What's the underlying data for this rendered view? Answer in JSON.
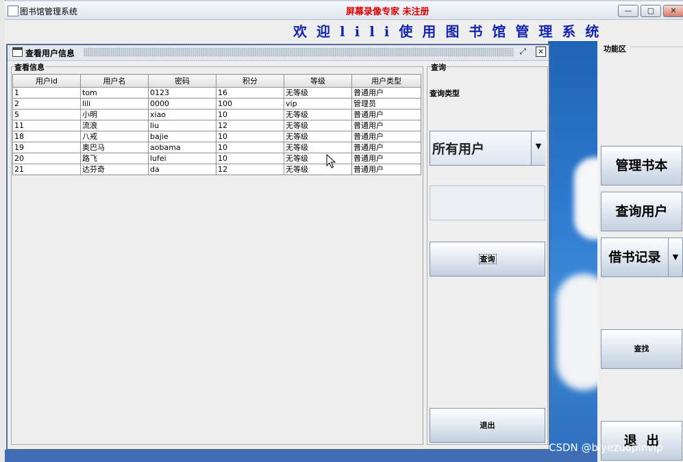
{
  "window": {
    "title": "图书馆管理系统",
    "recorder_watermark": "屏幕录像专家  未注册",
    "controls": [
      "—",
      "▢",
      "✕"
    ]
  },
  "banner": "欢迎lili使用图书馆管理系统",
  "internal_frame": {
    "title": "查看用户信息",
    "view_group_label": "查看信息",
    "query_group_label": "查询",
    "query_type_label": "查询类型",
    "user_type_combo": "所有用户",
    "query_field_value": "",
    "query_button": "查询",
    "exit_button": "退出"
  },
  "table": {
    "columns": [
      "用户id",
      "用户名",
      "密码",
      "积分",
      "等级",
      "用户类型"
    ],
    "rows": [
      [
        "1",
        "tom",
        "0123",
        "16",
        "无等级",
        "普通用户"
      ],
      [
        "2",
        "lili",
        "0000",
        "100",
        "vip",
        "管理员"
      ],
      [
        "5",
        "小明",
        "xiao",
        "10",
        "无等级",
        "普通用户"
      ],
      [
        "11",
        "流浪",
        "liu",
        "12",
        "无等级",
        "普通用户"
      ],
      [
        "18",
        "八戒",
        "bajie",
        "10",
        "无等级",
        "普通用户"
      ],
      [
        "19",
        "奥巴马",
        "aobama",
        "10",
        "无等级",
        "普通用户"
      ],
      [
        "20",
        "路飞",
        "lufei",
        "10",
        "无等级",
        "普通用户"
      ],
      [
        "21",
        "达芬奇",
        "da",
        "12",
        "无等级",
        "普通用户"
      ]
    ]
  },
  "function_panel": {
    "label": "功能区",
    "manage_books": "管理书本",
    "query_users": "查询用户",
    "borrow_records": "借书记录",
    "find": "查找",
    "exit": "退  出"
  },
  "desktop_watermark": "CSDN @biyezuopinvip",
  "colors": {
    "banner_text": "#1325b0",
    "recorder_watermark": "#e10000",
    "frame_border": "#4d6d9a"
  }
}
